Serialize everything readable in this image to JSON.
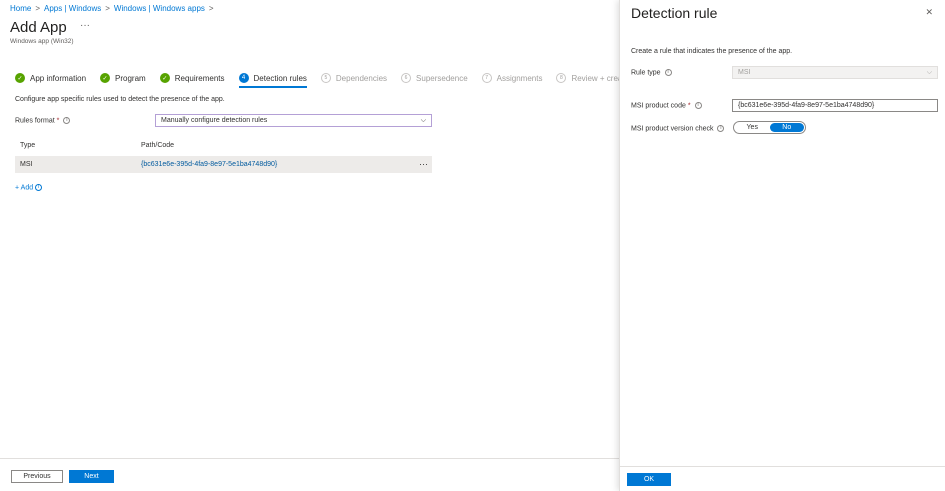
{
  "breadcrumb": [
    "Home",
    "Apps | Windows",
    "Windows | Windows apps"
  ],
  "title": "Add App",
  "subtitle": "Windows app (Win32)",
  "more": "···",
  "steps": [
    {
      "num": "✓",
      "label": "App information",
      "state": "done"
    },
    {
      "num": "✓",
      "label": "Program",
      "state": "done"
    },
    {
      "num": "✓",
      "label": "Requirements",
      "state": "done"
    },
    {
      "num": "4",
      "label": "Detection rules",
      "state": "current"
    },
    {
      "num": "5",
      "label": "Dependencies",
      "state": "todo"
    },
    {
      "num": "6",
      "label": "Supersedence",
      "state": "todo"
    },
    {
      "num": "7",
      "label": "Assignments",
      "state": "todo"
    },
    {
      "num": "8",
      "label": "Review + create",
      "state": "todo"
    }
  ],
  "description": "Configure app specific rules used to detect the presence of the app.",
  "rules_format": {
    "label": "Rules format",
    "required": "*",
    "value": "Manually configure detection rules"
  },
  "table": {
    "headers": [
      "Type",
      "Path/Code"
    ],
    "rows": [
      {
        "type": "MSI",
        "path": "{bc631e6e-395d-4fa9-8e97-5e1ba4748d90}",
        "menu": "···"
      }
    ]
  },
  "add_label": "+ Add",
  "footer": {
    "previous": "Previous",
    "next": "Next"
  },
  "panel": {
    "title": "Detection rule",
    "close": "✕",
    "description": "Create a rule that indicates the presence of the app.",
    "rule_type": {
      "label": "Rule type",
      "value": "MSI"
    },
    "product_code": {
      "label": "MSI product code",
      "required": "*",
      "value": "{bc631e6e-395d-4fa9-8e97-5e1ba4748d90}"
    },
    "version_check": {
      "label": "MSI product version check",
      "options": [
        "Yes",
        "No"
      ],
      "selected": "No"
    },
    "ok": "OK"
  }
}
